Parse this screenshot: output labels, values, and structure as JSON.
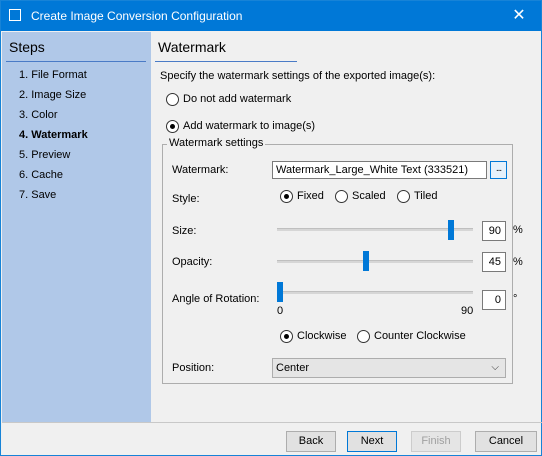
{
  "window": {
    "title": "Create Image Conversion Configuration",
    "close_glyph": "✕"
  },
  "sidebar": {
    "title": "Steps",
    "items": [
      {
        "label": "1. File Format"
      },
      {
        "label": "2. Image Size"
      },
      {
        "label": "3. Color"
      },
      {
        "label": "4. Watermark",
        "active": true
      },
      {
        "label": "5. Preview"
      },
      {
        "label": "6. Cache"
      },
      {
        "label": "7. Save"
      }
    ]
  },
  "main": {
    "heading": "Watermark",
    "instruction": "Specify the watermark settings of the exported image(s):",
    "options": {
      "no_watermark": {
        "label": "Do not add watermark",
        "selected": false
      },
      "add_watermark": {
        "label": "Add watermark to image(s)",
        "selected": true
      }
    },
    "group": {
      "legend": "Watermark settings",
      "watermark_label": "Watermark:",
      "watermark_value": "Watermark_Large_White Text (333521)",
      "browse_label": "...",
      "style_label": "Style:",
      "style_options": [
        {
          "label": "Fixed",
          "selected": true
        },
        {
          "label": "Scaled",
          "selected": false
        },
        {
          "label": "Tiled",
          "selected": false
        }
      ],
      "size": {
        "label": "Size:",
        "value": "90",
        "unit": "%",
        "fraction": 0.9
      },
      "opacity": {
        "label": "Opacity:",
        "value": "45",
        "unit": "%",
        "fraction": 0.45
      },
      "rotation": {
        "label": "Angle of Rotation:",
        "value": "0",
        "unit": "°",
        "min_label": "0",
        "max_label": "90",
        "fraction": 0
      },
      "direction_options": [
        {
          "label": "Clockwise",
          "selected": true
        },
        {
          "label": "Counter Clockwise",
          "selected": false
        }
      ],
      "position_label": "Position:",
      "position_value": "Center",
      "dropdown_arrow": "⌵"
    }
  },
  "footer": {
    "back": "Back",
    "next": "Next",
    "finish": "Finish",
    "cancel": "Cancel"
  },
  "colors": {
    "titlebar": "#0078d7",
    "sidebar": "#b0c8e8",
    "accent": "#0078d7"
  }
}
